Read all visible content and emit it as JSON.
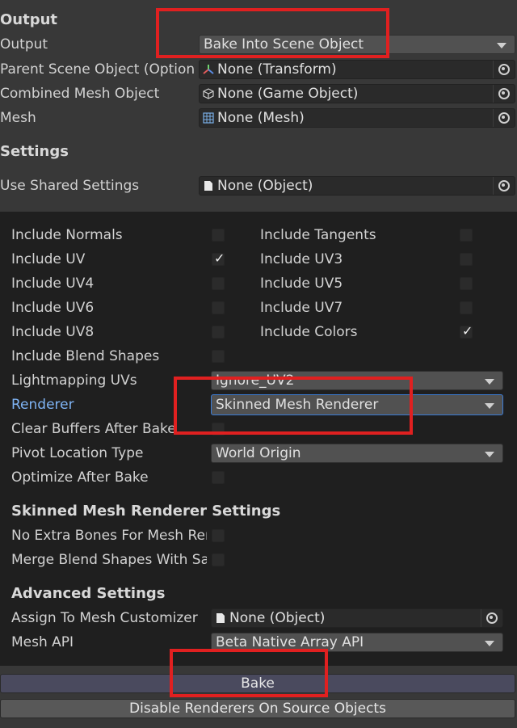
{
  "output_section": {
    "header": "Output",
    "rows": [
      {
        "label": "Output",
        "value": "Bake Into Scene Object"
      },
      {
        "label": "Parent Scene Object (Optional)",
        "value": "None (Transform)"
      },
      {
        "label": "Combined Mesh Object",
        "value": "None (Game Object)"
      },
      {
        "label": "Mesh",
        "value": "None (Mesh)"
      }
    ]
  },
  "settings_section": {
    "header": "Settings",
    "use_shared_label": "Use Shared Settings",
    "use_shared_value": "None (Object)"
  },
  "includes": [
    {
      "label": "Include Normals",
      "checked": false
    },
    {
      "label": "Include Tangents",
      "checked": false
    },
    {
      "label": "Include UV",
      "checked": true
    },
    {
      "label": "Include UV3",
      "checked": false
    },
    {
      "label": "Include UV4",
      "checked": false
    },
    {
      "label": "Include UV5",
      "checked": false
    },
    {
      "label": "Include UV6",
      "checked": false
    },
    {
      "label": "Include UV7",
      "checked": false
    },
    {
      "label": "Include UV8",
      "checked": false
    },
    {
      "label": "Include Colors",
      "checked": true
    },
    {
      "label": "Include Blend Shapes",
      "checked": false
    }
  ],
  "bake_settings": {
    "lightmapping_label": "Lightmapping UVs",
    "lightmapping_value": "Ignore_UV2",
    "renderer_label": "Renderer",
    "renderer_value": "Skinned Mesh Renderer",
    "clear_buffers_label": "Clear Buffers After Bake",
    "pivot_label": "Pivot Location Type",
    "pivot_value": "World Origin",
    "optimize_label": "Optimize After Bake"
  },
  "skinned_section": {
    "header": "Skinned Mesh Renderer Settings",
    "no_extra_bones_label": "No Extra Bones For Mesh Renderers",
    "merge_blend_label": "Merge Blend Shapes With Same Names"
  },
  "advanced_section": {
    "header": "Advanced Settings",
    "assign_label": "Assign To Mesh Customizer",
    "assign_value": "None (Object)",
    "mesh_api_label": "Mesh API",
    "mesh_api_value": "Beta Native Array API"
  },
  "buttons": {
    "bake": "Bake",
    "disable_renderers": "Disable Renderers On Source Objects"
  },
  "colors": {
    "background": "#383838",
    "panel": "#1f1f1f",
    "highlight_red": "#e02020",
    "renderer_label_blue": "#7fb4f5",
    "focus_border": "#3a7bd5"
  },
  "icons": [
    "transform-icon",
    "gameobject-icon",
    "mesh-icon",
    "document-icon",
    "object-picker-icon",
    "dropdown-caret-icon",
    "checkmark-icon"
  ]
}
